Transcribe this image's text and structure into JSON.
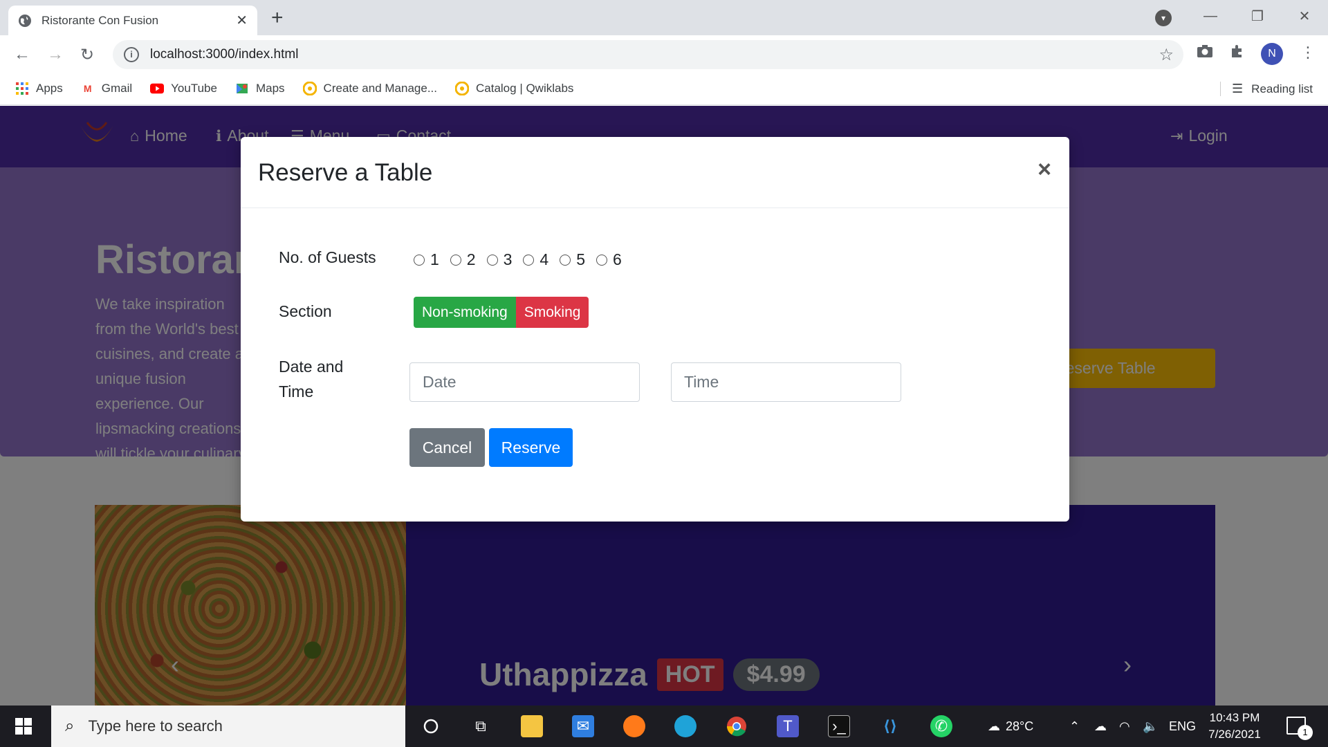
{
  "browser": {
    "tab_title": "Ristorante Con Fusion",
    "url": "localhost:3000/index.html",
    "bookmarks": [
      {
        "label": "Apps",
        "icon": "apps-grid-icon",
        "color": "#4285f4"
      },
      {
        "label": "Gmail",
        "icon": "gmail-icon",
        "color": "#ea4335"
      },
      {
        "label": "YouTube",
        "icon": "youtube-icon",
        "color": "#ff0000"
      },
      {
        "label": "Maps",
        "icon": "maps-icon",
        "color": "#34a853"
      },
      {
        "label": "Create and Manage...",
        "icon": "qwiklabs-icon",
        "color": "#f4b400"
      },
      {
        "label": "Catalog | Qwiklabs",
        "icon": "qwiklabs-icon",
        "color": "#f4b400"
      }
    ],
    "reading_list": "Reading list",
    "profile_initial": "N"
  },
  "site": {
    "nav": {
      "home": "Home",
      "about": "About",
      "menu": "Menu",
      "contact": "Contact",
      "login": "Login"
    },
    "jumbotron": {
      "title": "Ristorante con Fusion",
      "text": "We take inspiration from the World's best cuisines, and create a unique fusion experience. Our lipsmacking creations will tickle your culinary senses!",
      "reserve_button": "Reserve Table"
    },
    "carousel": {
      "dish_name": "Uthappizza",
      "badge": "HOT",
      "price": "$4.99"
    }
  },
  "modal": {
    "title": "Reserve a Table",
    "close": "×",
    "guests_label": "No. of Guests",
    "guest_options": [
      "1",
      "2",
      "3",
      "4",
      "5",
      "6"
    ],
    "section_label": "Section",
    "section_options": [
      "Non-smoking",
      "Smoking"
    ],
    "datetime_label_line1": "Date and",
    "datetime_label_line2": "Time",
    "date_placeholder": "Date",
    "time_placeholder": "Time",
    "cancel": "Cancel",
    "reserve": "Reserve"
  },
  "taskbar": {
    "search_placeholder": "Type here to search",
    "weather": "28°C",
    "language": "ENG",
    "time": "10:43 PM",
    "date": "7/26/2021",
    "notifications": "1"
  },
  "colors": {
    "nav_purple": "#512da8",
    "jumbotron_purple": "#9575cd",
    "carousel_purple": "#311b92",
    "reserve_yellow": "#ffc107",
    "success": "#28a745",
    "danger": "#dc3545",
    "primary": "#007bff",
    "secondary": "#6c757d"
  }
}
